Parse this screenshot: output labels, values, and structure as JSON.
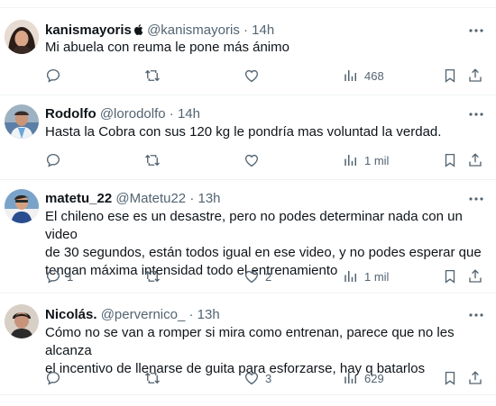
{
  "tweets": [
    {
      "name": "kanismayoris",
      "handle": "@kanismayoris",
      "sep": "·",
      "time": "14h",
      "verified_apple": true,
      "text": [
        "Mi abuela con reuma le pone más ánimo"
      ],
      "replies": "",
      "likes": "",
      "views": "468"
    },
    {
      "name": "Rodolfo",
      "handle": "@lorodolfo",
      "sep": "·",
      "time": "14h",
      "verified_apple": false,
      "text": [
        "Hasta la Cobra con sus 120 kg le pondría mas voluntad la verdad."
      ],
      "replies": "",
      "likes": "",
      "views": "1 mil"
    },
    {
      "name": "matetu_22",
      "handle": "@Matetu22",
      "sep": "·",
      "time": "13h",
      "verified_apple": false,
      "text": [
        "El chileno ese es un desastre, pero no podes determinar nada con un video",
        "de 30 segundos, están todos igual en ese video, y no podes esperar que",
        "tengan máxima intensidad todo el entrenamiento"
      ],
      "replies": "1",
      "likes": "2",
      "views": "1 mil"
    },
    {
      "name": "Nicolás.",
      "handle": "@pervernico_",
      "sep": "·",
      "time": "13h",
      "verified_apple": false,
      "text": [
        "Cómo no se van a romper si mira como entrenan, parece que no les alcanza",
        "el incentivo de llenarse de guita para esforzarse, hay q batarlos"
      ],
      "replies": "",
      "likes": "3",
      "views": "629"
    }
  ],
  "icons": {
    "reply": "reply-icon",
    "retweet": "retweet-icon",
    "like": "heart-icon",
    "views": "views-chart-icon",
    "bookmark": "bookmark-icon",
    "share": "share-icon",
    "more": "more-icon"
  },
  "colors": {
    "text": "#0f1419",
    "muted": "#536471",
    "divider": "#eff3f4"
  }
}
